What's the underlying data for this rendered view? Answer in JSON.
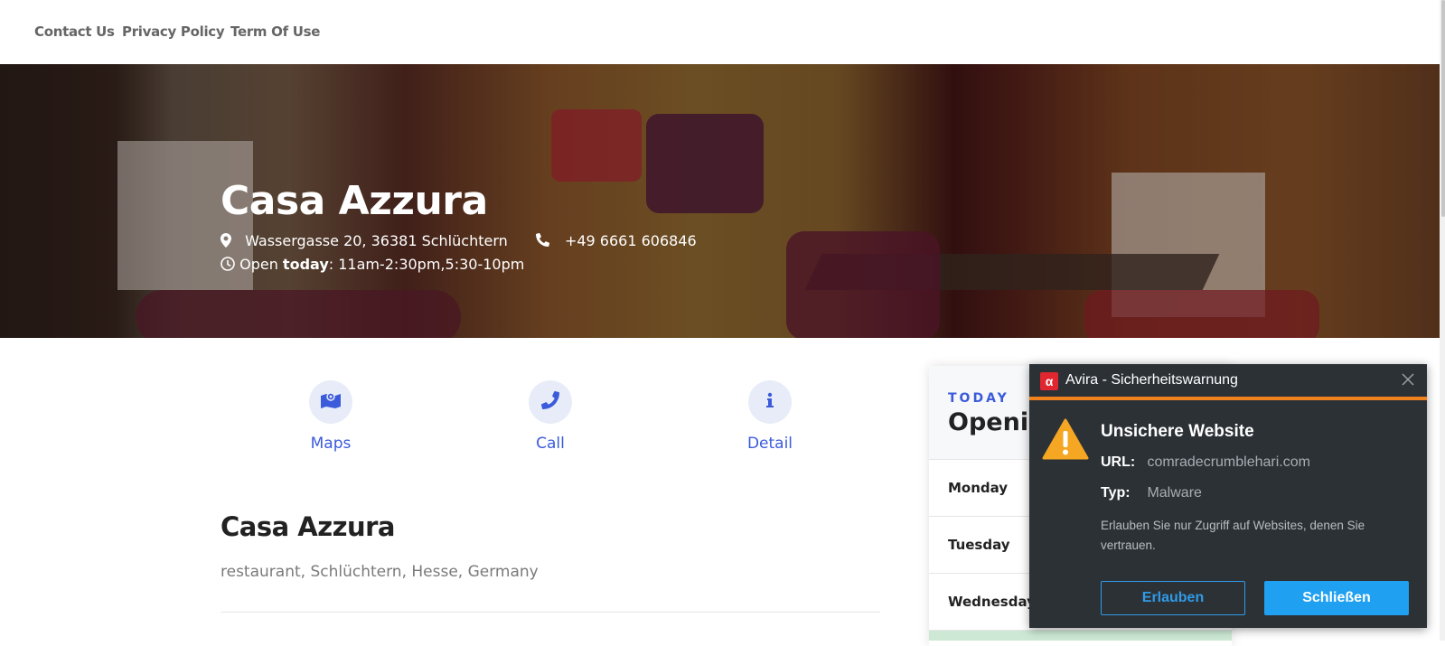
{
  "nav": {
    "links": [
      "Contact Us",
      "Privacy Policy",
      "Term Of Use"
    ]
  },
  "hero": {
    "title": "Casa Azzura",
    "address": "Wassergasse 20, 36381 Schlüchtern",
    "phone": "+49 6661 606846",
    "open_prefix": "Open",
    "open_today": "today",
    "open_hours": ": 11am-2:30pm,5:30-10pm"
  },
  "actions": [
    {
      "label": "Maps",
      "icon": "map-icon"
    },
    {
      "label": "Call",
      "icon": "phone-icon"
    },
    {
      "label": "Detail",
      "icon": "info-icon"
    }
  ],
  "info": {
    "title": "Casa Azzura",
    "subtitle": "restaurant, Schlüchtern, Hesse, Germany"
  },
  "hours": {
    "today_label": "TODAY",
    "title": "Opening Hours",
    "days": [
      "Monday",
      "Tuesday",
      "Wednesday"
    ]
  },
  "avira": {
    "window_title": "Avira - Sicherheitswarnung",
    "heading": "Unsichere Website",
    "url_key": "URL:",
    "url_value": "comradecrumblehari.com",
    "type_key": "Typ:",
    "type_value": "Malware",
    "note": "Erlauben Sie nur Zugriff auf Websites, denen Sie vertrauen.",
    "allow_label": "Erlauben",
    "close_label": "Schließen"
  },
  "colors": {
    "accent": "#3b5bdb",
    "avira_bg": "#2c3136",
    "avira_orange": "#f0821e",
    "avira_blue": "#1fa0f0"
  }
}
